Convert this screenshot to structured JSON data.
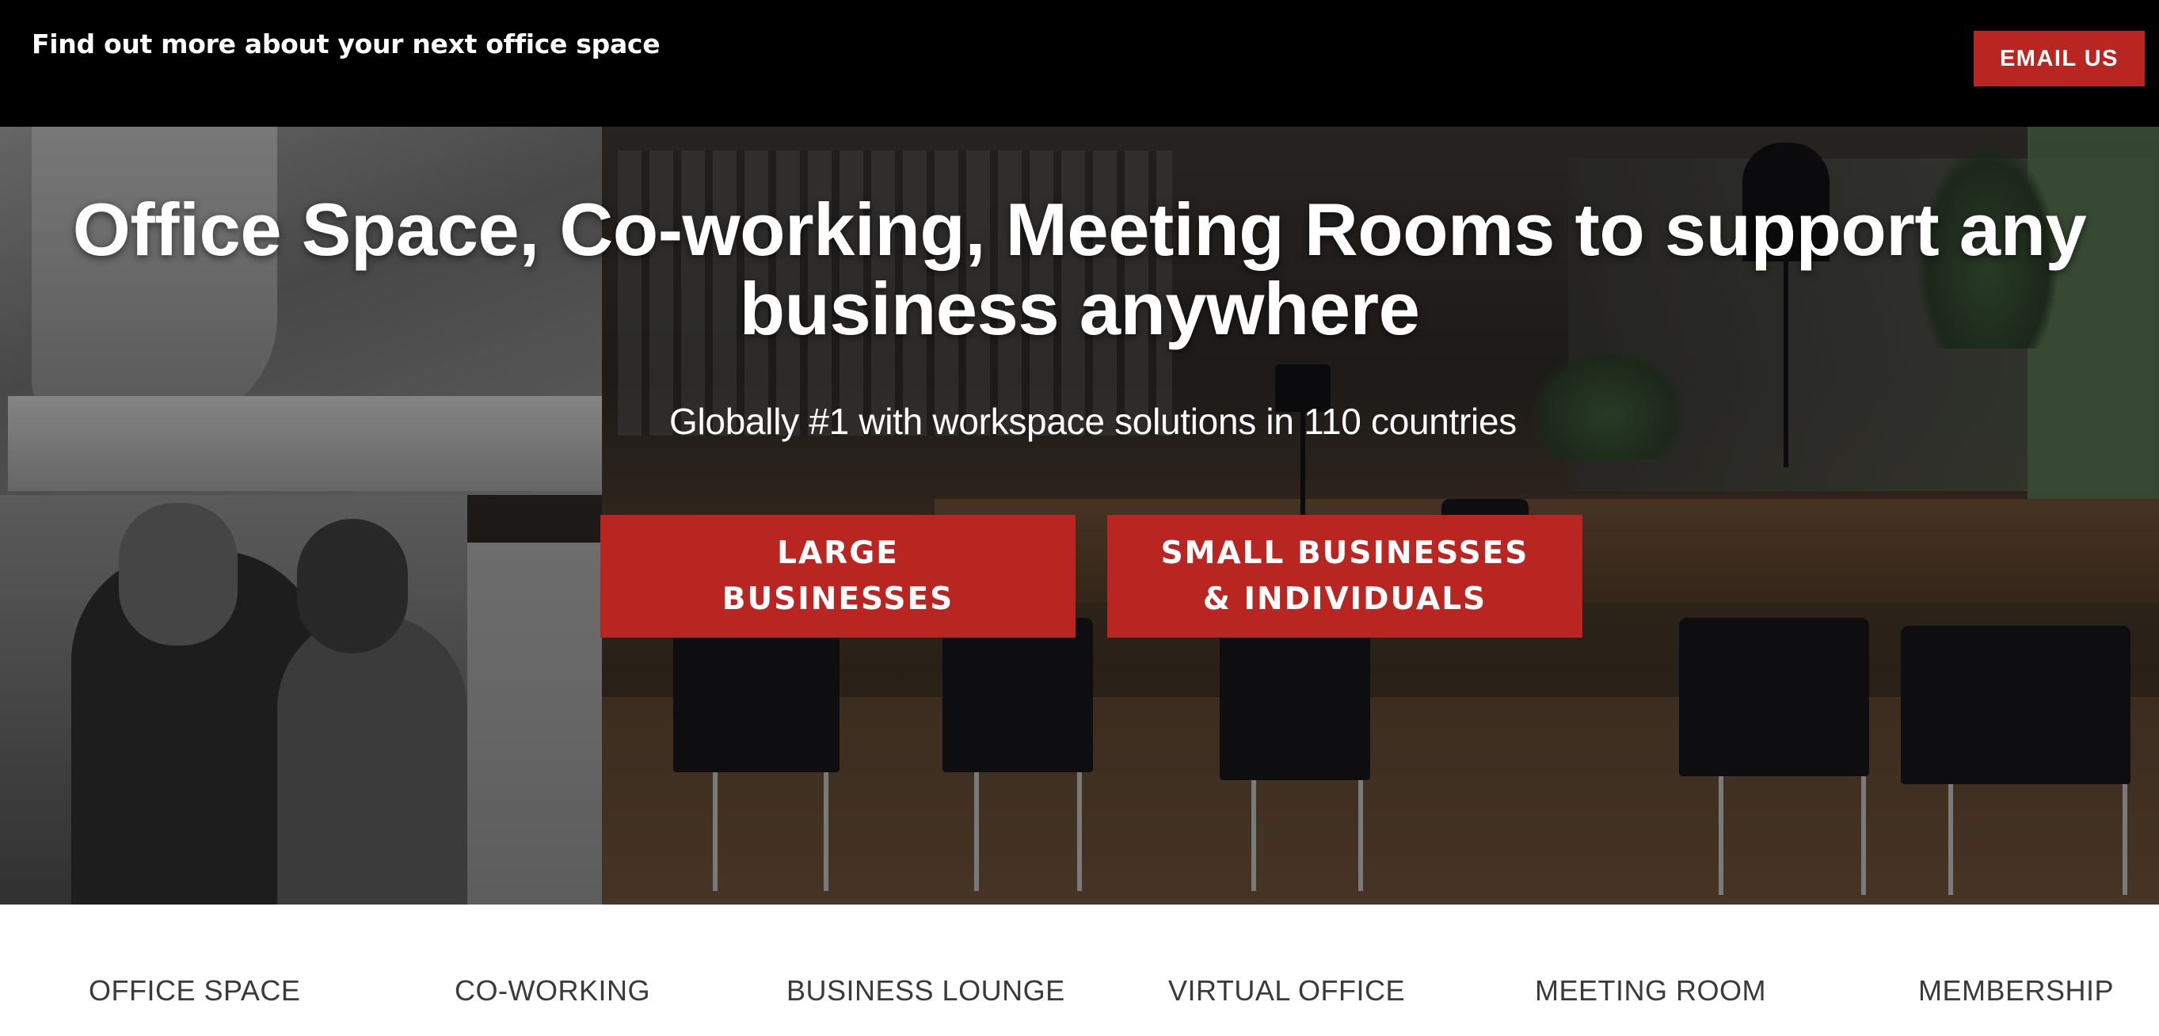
{
  "topbar": {
    "message": "Find out more about your next office space",
    "email_button": "EMAIL US"
  },
  "hero": {
    "title": "Office Space, Co-working, Meeting Rooms to support any business anywhere",
    "subtitle": "Globally #1 with workspace solutions in 110 countries",
    "cta_large": {
      "line1": "LARGE",
      "line2": "BUSINESSES"
    },
    "cta_small": {
      "line1": "SMALL BUSINESSES",
      "line2": "& INDIVIDUALS"
    }
  },
  "nav": {
    "items": [
      "OFFICE SPACE",
      "CO-WORKING",
      "BUSINESS LOUNGE",
      "VIRTUAL OFFICE",
      "MEETING ROOM",
      "MEMBERSHIP"
    ]
  },
  "colors": {
    "accent": "#b92621",
    "topbar_bg": "#000000",
    "nav_text": "#3a3a3e"
  }
}
